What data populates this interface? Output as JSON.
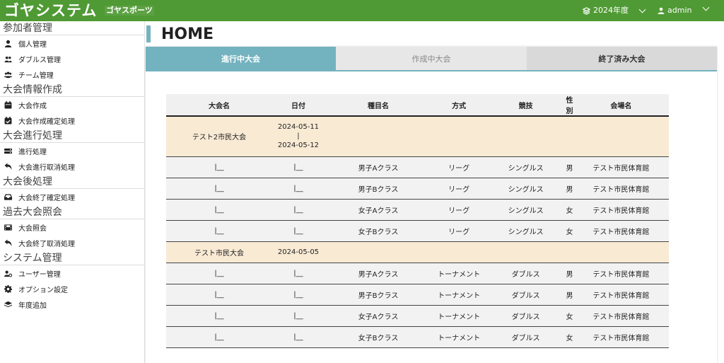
{
  "header": {
    "logo": "ゴヤシステム",
    "logo_sub": "ゴヤスポーツ",
    "year": "2024年度",
    "user": "admin"
  },
  "sidebar": {
    "sections": [
      {
        "title": "参加者管理",
        "items": [
          {
            "label": "個人管理",
            "icon": "user-icon"
          },
          {
            "label": "ダブルス管理",
            "icon": "users-icon"
          },
          {
            "label": "チーム管理",
            "icon": "team-icon"
          }
        ]
      },
      {
        "title": "大会情報作成",
        "items": [
          {
            "label": "大会作成",
            "icon": "calendar-icon"
          },
          {
            "label": "大会作成確定処理",
            "icon": "calendar-check-icon"
          }
        ]
      },
      {
        "title": "大会進行処理",
        "items": [
          {
            "label": "進行処理",
            "icon": "toggle-icon"
          },
          {
            "label": "大会進行取消処理",
            "icon": "undo-icon"
          }
        ]
      },
      {
        "title": "大会後処理",
        "items": [
          {
            "label": "大会終了確定処理",
            "icon": "inbox-icon"
          }
        ]
      },
      {
        "title": "過去大会照会",
        "items": [
          {
            "label": "大会照会",
            "icon": "film-icon"
          },
          {
            "label": "大会終了取消処理",
            "icon": "undo-icon"
          }
        ]
      },
      {
        "title": "システム管理",
        "items": [
          {
            "label": "ユーザー管理",
            "icon": "user-cog-icon"
          },
          {
            "label": "オプション設定",
            "icon": "gear-icon"
          },
          {
            "label": "年度追加",
            "icon": "layers-icon"
          }
        ]
      }
    ]
  },
  "main": {
    "title": "HOME",
    "tabs": [
      "進行中大会",
      "作成中大会",
      "終了済み大会"
    ],
    "table": {
      "headers": [
        "大会名",
        "日付",
        "種目名",
        "方式",
        "競技",
        "性別",
        "会場名"
      ],
      "branch_mark": "|__",
      "groups": [
        {
          "name": "テスト2市民大会",
          "date_start": "2024-05-11",
          "date_sep": "|",
          "date_end": "2024-05-12",
          "rows": [
            {
              "event": "男子Aクラス",
              "mode": "リーグ",
              "game": "シングルス",
              "sex": "男",
              "venue": "テスト市民体育館"
            },
            {
              "event": "男子Bクラス",
              "mode": "リーグ",
              "game": "シングルス",
              "sex": "男",
              "venue": "テスト市民体育館"
            },
            {
              "event": "女子Aクラス",
              "mode": "リーグ",
              "game": "シングルス",
              "sex": "女",
              "venue": "テスト市民体育館"
            },
            {
              "event": "女子Bクラス",
              "mode": "リーグ",
              "game": "シングルス",
              "sex": "女",
              "venue": "テスト市民体育館"
            }
          ]
        },
        {
          "name": "テスト市民大会",
          "date_start": "2024-05-05",
          "rows": [
            {
              "event": "男子Aクラス",
              "mode": "トーナメント",
              "game": "ダブルス",
              "sex": "男",
              "venue": "テスト市民体育館"
            },
            {
              "event": "男子Bクラス",
              "mode": "トーナメント",
              "game": "ダブルス",
              "sex": "男",
              "venue": "テスト市民体育館"
            },
            {
              "event": "女子Aクラス",
              "mode": "トーナメント",
              "game": "ダブルス",
              "sex": "女",
              "venue": "テスト市民体育館"
            },
            {
              "event": "女子Bクラス",
              "mode": "トーナメント",
              "game": "ダブルス",
              "sex": "女",
              "venue": "テスト市民体育館"
            }
          ]
        }
      ]
    }
  }
}
